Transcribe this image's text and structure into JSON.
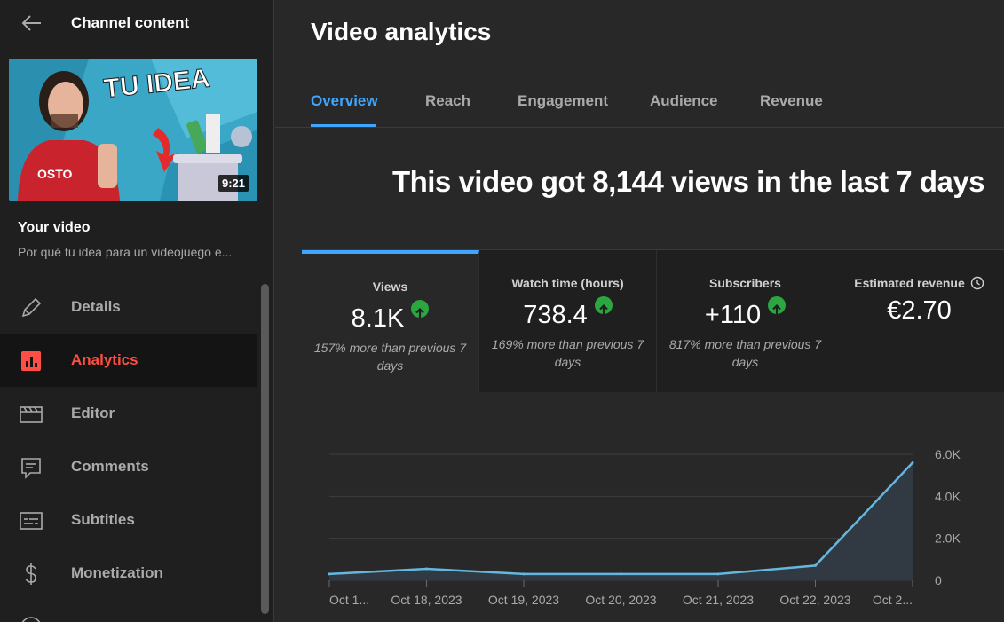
{
  "sidebar": {
    "header_title": "Channel content",
    "video_duration": "9:21",
    "thumbnail_text": "TU IDEA",
    "your_video_label": "Your video",
    "video_title": "Por qué tu idea para un videojuego e...",
    "items": [
      {
        "label": "Details",
        "icon": "pencil-icon"
      },
      {
        "label": "Analytics",
        "icon": "analytics-icon",
        "active": true
      },
      {
        "label": "Editor",
        "icon": "clapperboard-icon"
      },
      {
        "label": "Comments",
        "icon": "comment-icon"
      },
      {
        "label": "Subtitles",
        "icon": "subtitles-icon"
      },
      {
        "label": "Monetization",
        "icon": "dollar-icon"
      }
    ]
  },
  "main": {
    "title": "Video analytics",
    "tabs": [
      "Overview",
      "Reach",
      "Engagement",
      "Audience",
      "Revenue"
    ],
    "active_tab": "Overview",
    "headline": "This video got 8,144 views in the last 7 days",
    "metrics": [
      {
        "label": "Views",
        "value": "8.1K",
        "note": "157% more than previous 7 days",
        "trend": "up"
      },
      {
        "label": "Watch time (hours)",
        "value": "738.4",
        "note": "169% more than previous 7 days",
        "trend": "up"
      },
      {
        "label": "Subscribers",
        "value": "+110",
        "note": "817% more than previous 7 days",
        "trend": "up"
      },
      {
        "label": "Estimated revenue",
        "value": "€2.70",
        "note": "",
        "trend": "none"
      }
    ]
  },
  "colors": {
    "accent_blue": "#3ea6ff",
    "analytics_red": "#ff4e45",
    "trend_green": "#2ba640",
    "line_color": "#65b7e0"
  },
  "chart_data": {
    "type": "area",
    "x": [
      "Oct 1...",
      "Oct 18, 2023",
      "Oct 19, 2023",
      "Oct 20, 2023",
      "Oct 21, 2023",
      "Oct 22, 2023",
      "Oct 2..."
    ],
    "series": [
      {
        "values": [
          300,
          550,
          300,
          300,
          300,
          700,
          5600
        ]
      }
    ],
    "y_ticks": [
      "6.0K",
      "4.0K",
      "2.0K",
      "0"
    ],
    "ylim": [
      0,
      6000
    ],
    "grid": true
  }
}
